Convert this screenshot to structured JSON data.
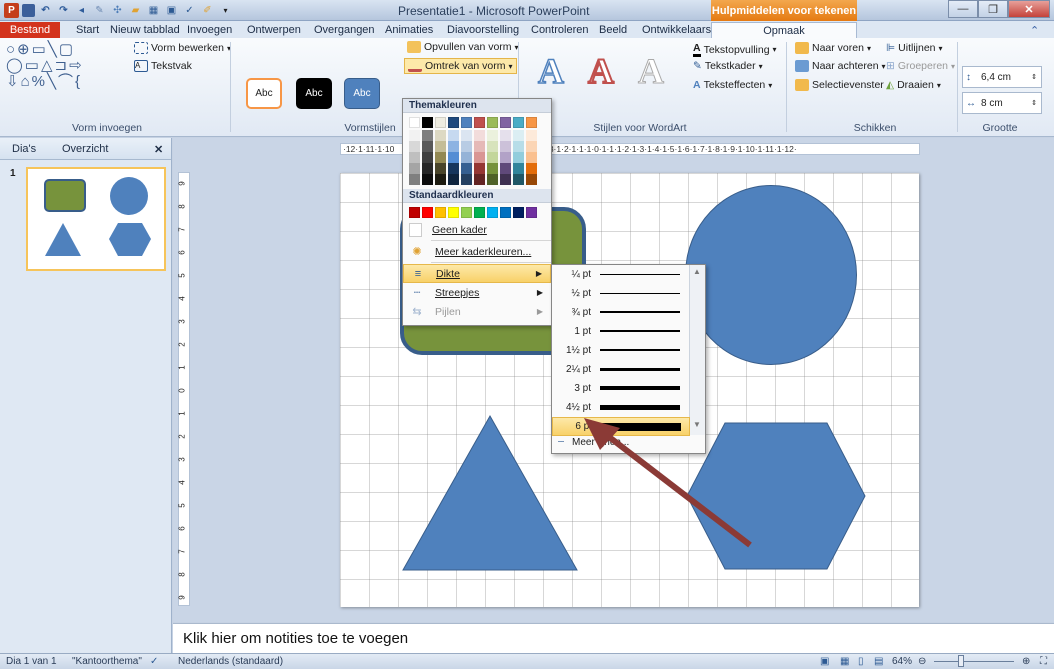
{
  "window": {
    "title": "Presentatie1 - Microsoft PowerPoint",
    "context_tab_group": "Hulpmiddelen voor tekenen"
  },
  "tabs": [
    "Bestand",
    "Start",
    "Nieuw tabblad",
    "Invoegen",
    "Ontwerpen",
    "Overgangen",
    "Animaties",
    "Diavoorstelling",
    "Controleren",
    "Beeld",
    "Ontwikkelaars",
    "Opmaak"
  ],
  "ribbon": {
    "vorm_bewerken": "Vorm bewerken",
    "tekstvak": "Tekstvak",
    "group_vorm_invoegen": "Vorm invoegen",
    "style_label": "Abc",
    "opvullen": "Opvullen van vorm",
    "omtrek": "Omtrek van vorm",
    "group_vormstijlen": "Vormstijlen",
    "tekstopvulling": "Tekstopvulling",
    "tekstkader": "Tekstkader",
    "teksteffecten": "Teksteffecten",
    "group_wordart": "Stijlen voor WordArt",
    "naar_voren": "Naar voren",
    "naar_achteren": "Naar achteren",
    "selectievenster": "Selectievenster",
    "uitlijnen": "Uitlijnen",
    "groeperen": "Groeperen",
    "draaien": "Draaien",
    "group_schikken": "Schikken",
    "height": "6,4 cm",
    "width": "8 cm",
    "group_grootte": "Grootte"
  },
  "panel": {
    "tab_slides": "Dia's",
    "tab_outline": "Overzicht",
    "close": "✕",
    "slide_number": "1"
  },
  "ruler": {
    "horizontal": "·12·1·11·1·10",
    "horizontal_right": "·3·1·2·1·1·1·0·1·1·1·2·1·3·1·4·1·5·1·6·1·7·1·8·1·9·1·10·1·11·1·12·",
    "vertical": [
      "9",
      "8",
      "7",
      "6",
      "5",
      "4",
      "3",
      "2",
      "1",
      "0",
      "1",
      "2",
      "3",
      "4",
      "5",
      "6",
      "7",
      "8",
      "9"
    ]
  },
  "menu": {
    "theme_colors_header": "Themakleuren",
    "standard_colors_header": "Standaardkleuren",
    "no_outline": "Geen kader",
    "more_colors": "Meer kaderkleuren...",
    "weight": "Dikte",
    "dashes": "Streepjes",
    "arrows": "Pijlen",
    "theme_top_row": [
      "#ffffff",
      "#000000",
      "#eeece1",
      "#1f497d",
      "#4f81bd",
      "#c0504d",
      "#9bbb59",
      "#8064a2",
      "#4bacc6",
      "#f79646"
    ],
    "theme_columns": [
      [
        "#f2f2f2",
        "#d8d8d8",
        "#bfbfbf",
        "#a5a5a5",
        "#7f7f7f"
      ],
      [
        "#7f7f7f",
        "#595959",
        "#3f3f3f",
        "#262626",
        "#0c0c0c"
      ],
      [
        "#ddd9c3",
        "#c4bd97",
        "#938953",
        "#494429",
        "#1d1b10"
      ],
      [
        "#c6d9f0",
        "#8db3e2",
        "#548dd4",
        "#17365d",
        "#0f243e"
      ],
      [
        "#dbe5f1",
        "#b8cce4",
        "#95b3d7",
        "#366092",
        "#244061"
      ],
      [
        "#f2dcdb",
        "#e5b9b7",
        "#d99694",
        "#953734",
        "#632423"
      ],
      [
        "#ebf1dd",
        "#d7e3bc",
        "#c3d69b",
        "#76923c",
        "#4f6128"
      ],
      [
        "#e5e0ec",
        "#ccc1d9",
        "#b2a2c7",
        "#5f497a",
        "#3f3151"
      ],
      [
        "#dbeef3",
        "#b7dde8",
        "#92cddc",
        "#31859b",
        "#205867"
      ],
      [
        "#fdeada",
        "#fbd5b5",
        "#fac08f",
        "#e36c09",
        "#974806"
      ]
    ],
    "standard_colors": [
      "#c00000",
      "#ff0000",
      "#ffc000",
      "#ffff00",
      "#92d050",
      "#00b050",
      "#00b0f0",
      "#0070c0",
      "#002060",
      "#7030a0"
    ]
  },
  "weight_submenu": {
    "items": [
      "¼ pt",
      "½ pt",
      "¾ pt",
      "1 pt",
      "1½ pt",
      "2¼ pt",
      "3 pt",
      "4½ pt",
      "6 pt"
    ],
    "more": "Meer lijnen..."
  },
  "notes": "Klik hier om notities toe te voegen",
  "status": {
    "slide": "Dia 1 van 1",
    "theme": "\"Kantoorthema\"",
    "language": "Nederlands (standaard)",
    "zoom": "64%"
  },
  "colors": {
    "shape_blue": "#4f81bd",
    "shape_green": "#77933c",
    "arrow_red": "#8b3a36",
    "highlight": "#f8d169"
  }
}
